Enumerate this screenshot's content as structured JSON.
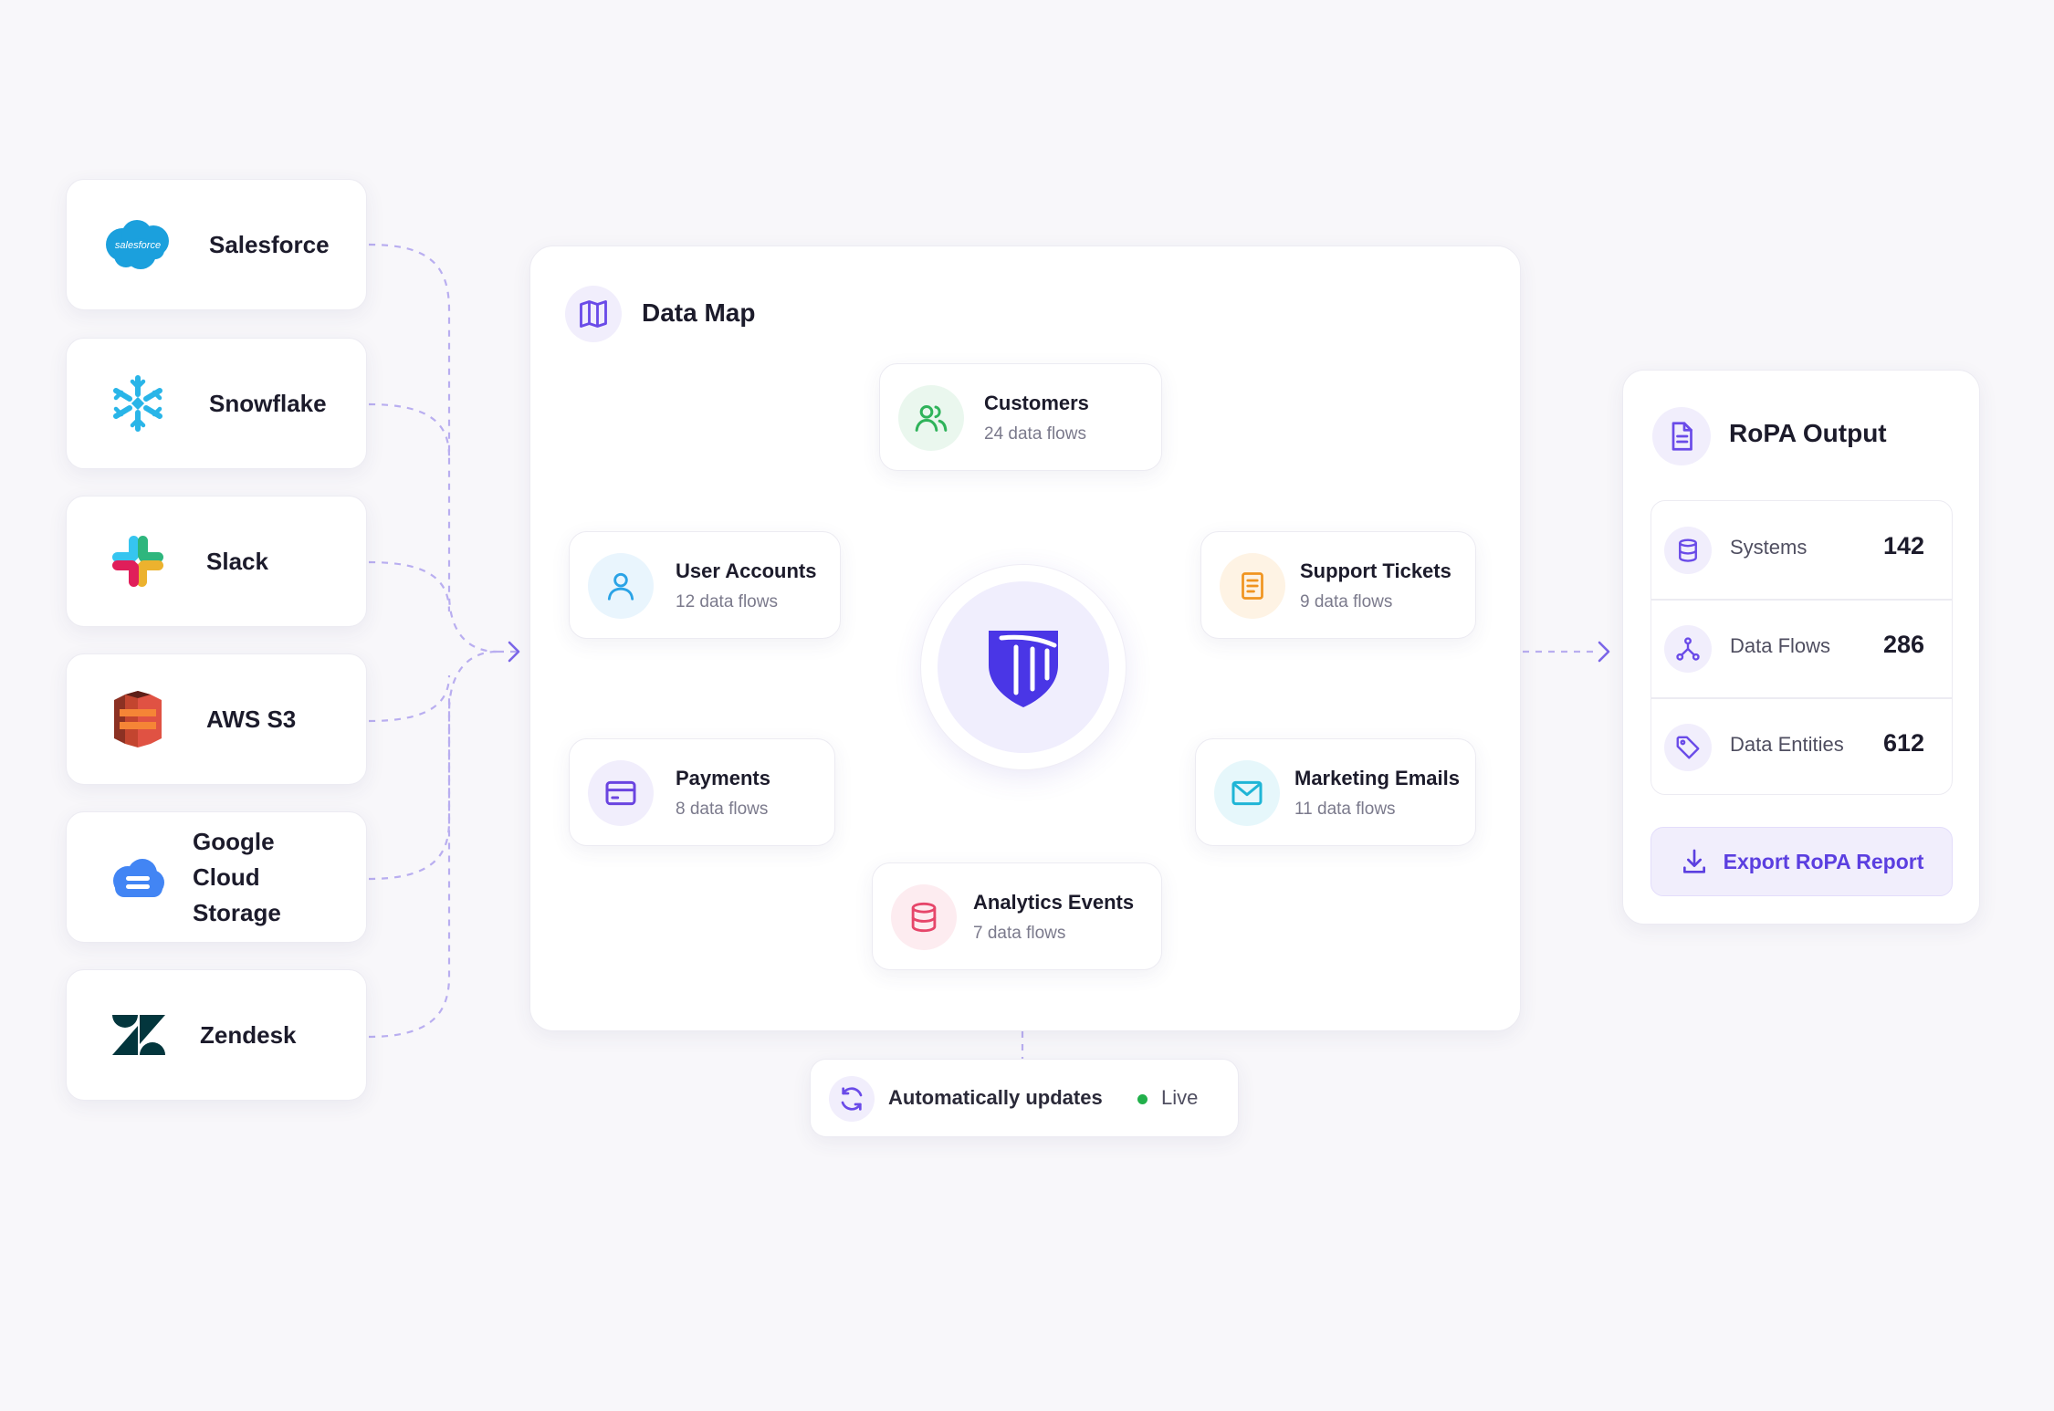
{
  "sources": [
    {
      "name": "Salesforce",
      "icon": "salesforce-logo"
    },
    {
      "name": "Snowflake",
      "icon": "snowflake-logo"
    },
    {
      "name": "Slack",
      "icon": "slack-logo"
    },
    {
      "name": "AWS S3",
      "icon": "aws-s3-logo"
    },
    {
      "name": "Google Cloud Storage",
      "icon": "google-cloud-logo"
    },
    {
      "name": "Zendesk",
      "icon": "zendesk-logo"
    }
  ],
  "data_map": {
    "title": "Data Map",
    "icon": "map-icon",
    "center_icon": "shield-logo",
    "nodes": [
      {
        "title": "Customers",
        "subtitle": "24 data flows",
        "icon": "users-icon",
        "color": "#2fb35a"
      },
      {
        "title": "User Accounts",
        "subtitle": "12 data flows",
        "icon": "user-icon",
        "color": "#2aa3e6"
      },
      {
        "title": "Support Tickets",
        "subtitle": "9 data flows",
        "icon": "document-icon",
        "color": "#f0941f"
      },
      {
        "title": "Payments",
        "subtitle": "8 data flows",
        "icon": "credit-card-icon",
        "color": "#6a44e0"
      },
      {
        "title": "Marketing Emails",
        "subtitle": "11 data flows",
        "icon": "mail-icon",
        "color": "#1fb5d6"
      },
      {
        "title": "Analytics Events",
        "subtitle": "7 data flows",
        "icon": "database-icon",
        "color": "#e6466a"
      }
    ]
  },
  "ropa": {
    "title": "RoPA Output",
    "icon": "file-icon",
    "metrics": [
      {
        "label": "Systems",
        "value": "142",
        "icon": "database-icon"
      },
      {
        "label": "Data Flows",
        "value": "286",
        "icon": "flows-icon"
      },
      {
        "label": "Data Entities",
        "value": "612",
        "icon": "tag-icon"
      }
    ],
    "export_label": "Export RoPA Report"
  },
  "status": {
    "label": "Automatically updates",
    "live_label": "Live",
    "live_color": "#22b04b"
  },
  "colors": {
    "accent": "#6a4be8",
    "connector": "#b9aef0",
    "background": "#f8f7fa"
  }
}
